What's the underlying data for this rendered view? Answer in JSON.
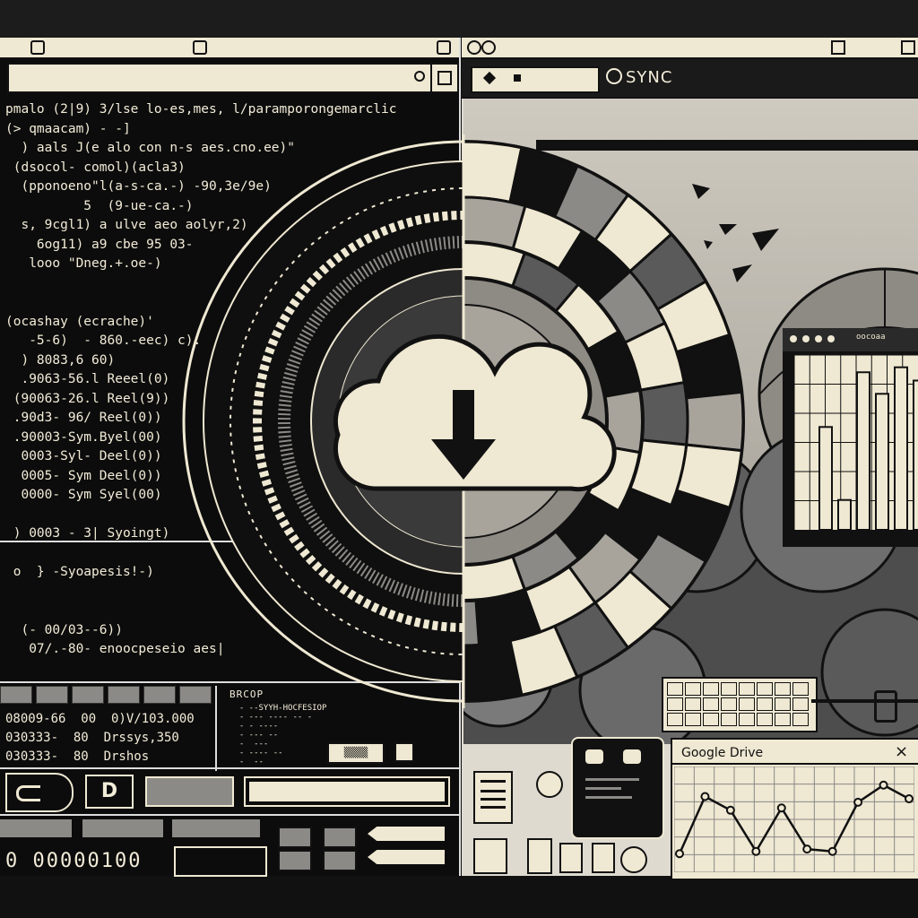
{
  "left_terminal": {
    "code_lines": [
      "pmalo (2|9) 3/lse lo-es,mes, l/paramporongemarclic",
      "(> qmaacam) - -]",
      "  ) aals J(e alo con n-s aes.cno.ee)\"",
      " (dsocol- comol)(acla3)",
      "  (pponoeno\"l(a-s-ca.-) -90,3e/9e)",
      "          5  (9-ue-ca.-)",
      "  s, 9cgl1) a ulve aeo aolyr,2)",
      "    6og11) a9 cbe 95 03-",
      "   looo \"Dneg.+.oe-)",
      "",
      "",
      "(ocashay (ecrache)'",
      "   -5-6)  - 860.-eec) c).",
      "  ) 8083,6 60)",
      "  .9063-56.l Reeel(0)",
      " (90063-26.l Reel(9))",
      " .90d3- 96/ Reel(0))",
      " .90003-Sym.Byel(00)",
      "  0003-Syl- Deel(0))",
      "  0005- Sym Deel(0))",
      "  0000- Sym Syel(00)",
      "",
      " ) 0003 - 3| Syoingt)",
      "",
      " o  } -Syoapesis!-)",
      "",
      "",
      "  (- 00/03--6))",
      "   07/.-80- enoocpeseio aes|"
    ],
    "bottom_lines": [
      "08009-66  00  0)V/103.000",
      "030333-  80  Drssys,350",
      "030333-  80  Drshos"
    ],
    "side_header": "BRCOP",
    "side_lines": [
      "  - --SYYH-HOCFESIOP",
      "  - --- ---- -- -",
      "  - - ----",
      "  - --- --",
      "  -  ---",
      "  - ---- --",
      "  -  --"
    ],
    "side_button": "▒▒▒▒",
    "counter": "0 00000100"
  },
  "right_app": {
    "sync_label": "SYNC",
    "chart_window": {
      "header_text": "oocoaa",
      "bars": [
        0.62,
        0.18,
        0.95,
        0.82,
        0.98,
        0.9
      ]
    },
    "google_drive": {
      "title": "Google Drive",
      "close": "×",
      "line_values": [
        10,
        60,
        48,
        12,
        50,
        14,
        12,
        55,
        70,
        58
      ]
    }
  },
  "colors": {
    "ink": "#111111",
    "paper": "#efe8d2",
    "mid_gray": "#8c8a86"
  },
  "icons": [
    "cloud-download-icon",
    "close-icon",
    "chat-bubble-icon",
    "document-icon",
    "pie-icon"
  ]
}
